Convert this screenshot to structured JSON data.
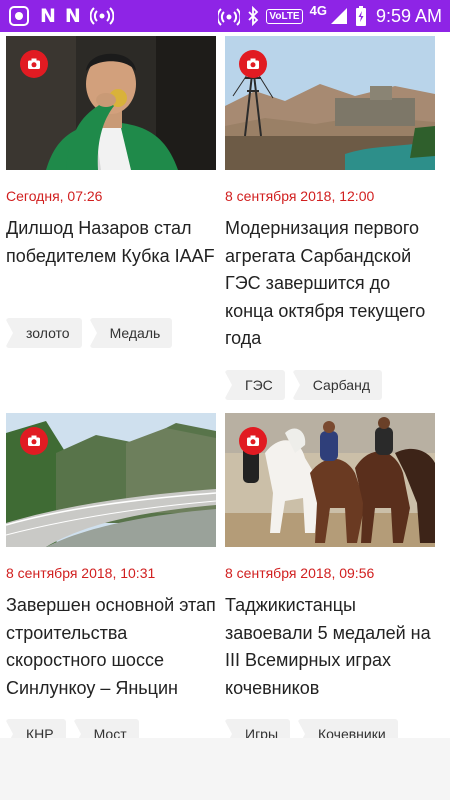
{
  "status_bar": {
    "network": "4G",
    "volte": "VoLTE",
    "time": "9:59 AM",
    "left_icons": [
      "screen-record-icon",
      "n-app-icon",
      "n-app-icon",
      "hotspot-icon"
    ],
    "right_icons": [
      "wifi-signal-icon",
      "bluetooth-icon",
      "signal-icon",
      "battery-icon"
    ],
    "bar_color": "#8e24e6"
  },
  "feed": {
    "articles": [
      {
        "date": "Сегодня, 07:26",
        "title": "Дилшод Назаров стал победителем Кубка IAAF",
        "tags": [
          "золото",
          "Медаль"
        ],
        "image": "athlete-with-medal-photo"
      },
      {
        "date": "8 сентября 2018, 12:00",
        "title": "Модернизация первого  агрегата Сарбандской ГЭС завершится до конца октября текущего года",
        "tags": [
          "ГЭС",
          "Сарбанд"
        ],
        "image": "hydro-power-station-photo"
      },
      {
        "date": "8 сентября 2018, 10:31",
        "title": "Завершен основной этап строительства скоростного шоссе Синлункоу – Яньцин",
        "tags": [
          "КНР",
          "Мост"
        ],
        "image": "highway-in-mountains-photo"
      },
      {
        "date": "8 сентября 2018, 09:56",
        "title": "Таджикистанцы завоевали 5 медалей на III Всемирных играх кочевников",
        "tags": [
          "Игры",
          "Кочевники"
        ],
        "image": "horse-riders-photo"
      }
    ]
  },
  "colors": {
    "accent": "#d11f1f",
    "camera_badge": "#e11b22",
    "tag_bg": "#f1f1f1"
  }
}
